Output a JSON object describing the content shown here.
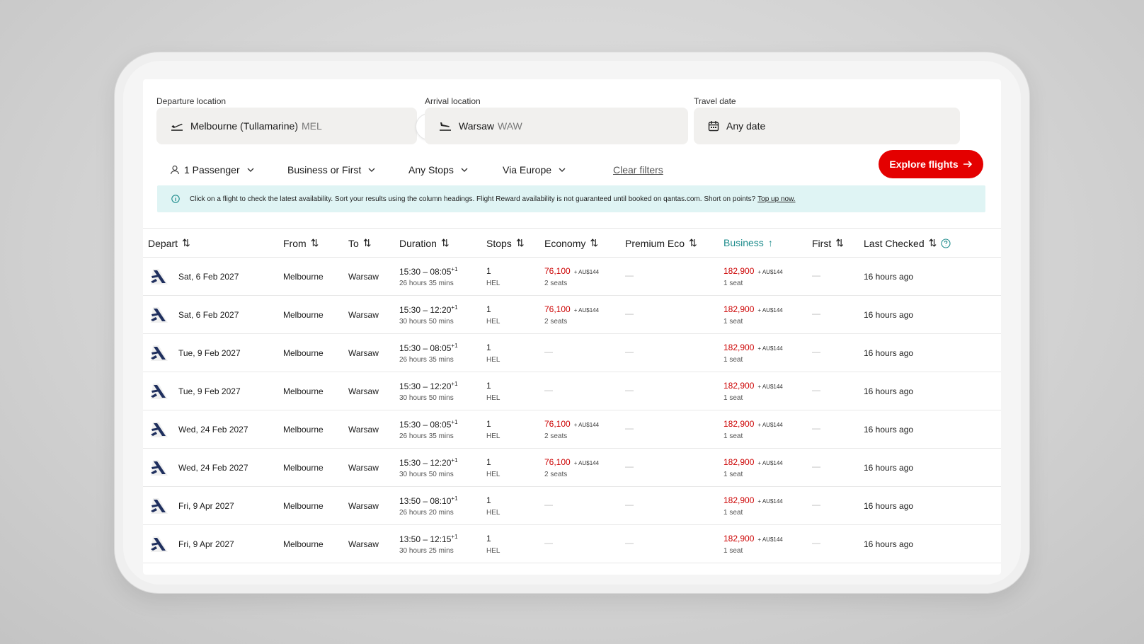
{
  "search": {
    "departure_label": "Departure location",
    "departure_city": "Melbourne (Tullamarine)",
    "departure_code": "MEL",
    "arrival_label": "Arrival location",
    "arrival_city": "Warsaw",
    "arrival_code": "WAW",
    "date_label": "Travel date",
    "date_value": "Any date"
  },
  "filters": {
    "passengers": "1 Passenger",
    "cabin": "Business or First",
    "stops": "Any Stops",
    "via": "Via Europe",
    "clear": "Clear filters",
    "explore": "Explore flights"
  },
  "info": {
    "text": "Click on a flight to check the latest availability. Sort your results using the column headings. Flight Reward availability is not guaranteed until booked on qantas.com. Short on points?",
    "link": "Top up now."
  },
  "columns": {
    "depart": "Depart",
    "from": "From",
    "to": "To",
    "duration": "Duration",
    "stops": "Stops",
    "economy": "Economy",
    "premium": "Premium Eco",
    "business": "Business",
    "first": "First",
    "checked": "Last Checked"
  },
  "colors": {
    "accent": "#e40000",
    "sorted_column": "#1e8c8c",
    "info_bg": "#dff4f4",
    "price": "#cc0000"
  },
  "rows": [
    {
      "date": "Sat, 6 Feb 2027",
      "from": "Melbourne",
      "to": "Warsaw",
      "time": "15:30 – 08:05",
      "plus": "+1",
      "duration": "26 hours 35 mins",
      "stops": "1",
      "via": "HEL",
      "economy": "76,100",
      "economy_tax": "+ AU$144",
      "economy_seats": "2 seats",
      "premium": "—",
      "business": "182,900",
      "business_tax": "+ AU$144",
      "business_seats": "1 seat",
      "first": "—",
      "checked": "16 hours ago"
    },
    {
      "date": "Sat, 6 Feb 2027",
      "from": "Melbourne",
      "to": "Warsaw",
      "time": "15:30 – 12:20",
      "plus": "+1",
      "duration": "30 hours 50 mins",
      "stops": "1",
      "via": "HEL",
      "economy": "76,100",
      "economy_tax": "+ AU$144",
      "economy_seats": "2 seats",
      "premium": "—",
      "business": "182,900",
      "business_tax": "+ AU$144",
      "business_seats": "1 seat",
      "first": "—",
      "checked": "16 hours ago"
    },
    {
      "date": "Tue, 9 Feb 2027",
      "from": "Melbourne",
      "to": "Warsaw",
      "time": "15:30 – 08:05",
      "plus": "+1",
      "duration": "26 hours 35 mins",
      "stops": "1",
      "via": "HEL",
      "economy": null,
      "economy_tax": "",
      "economy_seats": "",
      "premium": "—",
      "business": "182,900",
      "business_tax": "+ AU$144",
      "business_seats": "1 seat",
      "first": "—",
      "checked": "16 hours ago"
    },
    {
      "date": "Tue, 9 Feb 2027",
      "from": "Melbourne",
      "to": "Warsaw",
      "time": "15:30 – 12:20",
      "plus": "+1",
      "duration": "30 hours 50 mins",
      "stops": "1",
      "via": "HEL",
      "economy": null,
      "economy_tax": "",
      "economy_seats": "",
      "premium": "—",
      "business": "182,900",
      "business_tax": "+ AU$144",
      "business_seats": "1 seat",
      "first": "—",
      "checked": "16 hours ago"
    },
    {
      "date": "Wed, 24 Feb 2027",
      "from": "Melbourne",
      "to": "Warsaw",
      "time": "15:30 – 08:05",
      "plus": "+1",
      "duration": "26 hours 35 mins",
      "stops": "1",
      "via": "HEL",
      "economy": "76,100",
      "economy_tax": "+ AU$144",
      "economy_seats": "2 seats",
      "premium": "—",
      "business": "182,900",
      "business_tax": "+ AU$144",
      "business_seats": "1 seat",
      "first": "—",
      "checked": "16 hours ago"
    },
    {
      "date": "Wed, 24 Feb 2027",
      "from": "Melbourne",
      "to": "Warsaw",
      "time": "15:30 – 12:20",
      "plus": "+1",
      "duration": "30 hours 50 mins",
      "stops": "1",
      "via": "HEL",
      "economy": "76,100",
      "economy_tax": "+ AU$144",
      "economy_seats": "2 seats",
      "premium": "—",
      "business": "182,900",
      "business_tax": "+ AU$144",
      "business_seats": "1 seat",
      "first": "—",
      "checked": "16 hours ago"
    },
    {
      "date": "Fri, 9 Apr 2027",
      "from": "Melbourne",
      "to": "Warsaw",
      "time": "13:50 – 08:10",
      "plus": "+1",
      "duration": "26 hours 20 mins",
      "stops": "1",
      "via": "HEL",
      "economy": null,
      "economy_tax": "",
      "economy_seats": "",
      "premium": "—",
      "business": "182,900",
      "business_tax": "+ AU$144",
      "business_seats": "1 seat",
      "first": "—",
      "checked": "16 hours ago"
    },
    {
      "date": "Fri, 9 Apr 2027",
      "from": "Melbourne",
      "to": "Warsaw",
      "time": "13:50 – 12:15",
      "plus": "+1",
      "duration": "30 hours 25 mins",
      "stops": "1",
      "via": "HEL",
      "economy": null,
      "economy_tax": "",
      "economy_seats": "",
      "premium": "—",
      "business": "182,900",
      "business_tax": "+ AU$144",
      "business_seats": "1 seat",
      "first": "—",
      "checked": "16 hours ago"
    }
  ]
}
